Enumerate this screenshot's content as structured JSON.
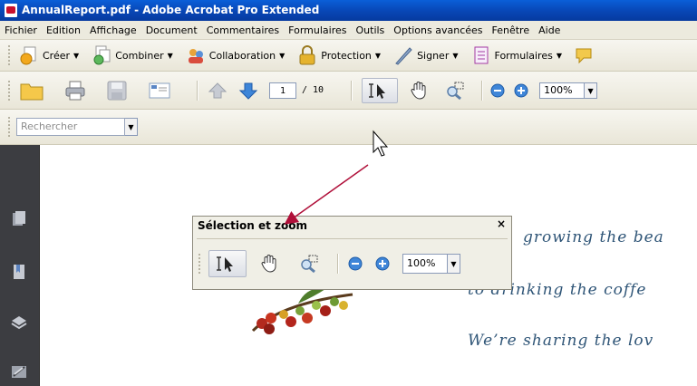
{
  "window": {
    "title": "AnnualReport.pdf - Adobe Acrobat Pro Extended"
  },
  "menubar": [
    "Fichier",
    "Edition",
    "Affichage",
    "Document",
    "Commentaires",
    "Formulaires",
    "Outils",
    "Options avancées",
    "Fenêtre",
    "Aide"
  ],
  "tasks_toolbar": {
    "create": "Créer",
    "combine": "Combiner",
    "collaboration": "Collaboration",
    "protection": "Protection",
    "sign": "Signer",
    "forms": "Formulaires"
  },
  "file_toolbar": {
    "current_page": "1",
    "page_total": "/ 10",
    "zoom": "100%"
  },
  "search": {
    "placeholder": "Rechercher"
  },
  "float_toolbar": {
    "title": "Sélection et zoom",
    "close": "×",
    "zoom": "100%"
  },
  "document_text": [
    "growing the bea",
    "to drinking the coffe",
    "We’re sharing the lov"
  ],
  "colors": {
    "titlebar": "#0a5fd8",
    "doc_text": "#2f5577",
    "annotation_arrow": "#b0103a"
  }
}
